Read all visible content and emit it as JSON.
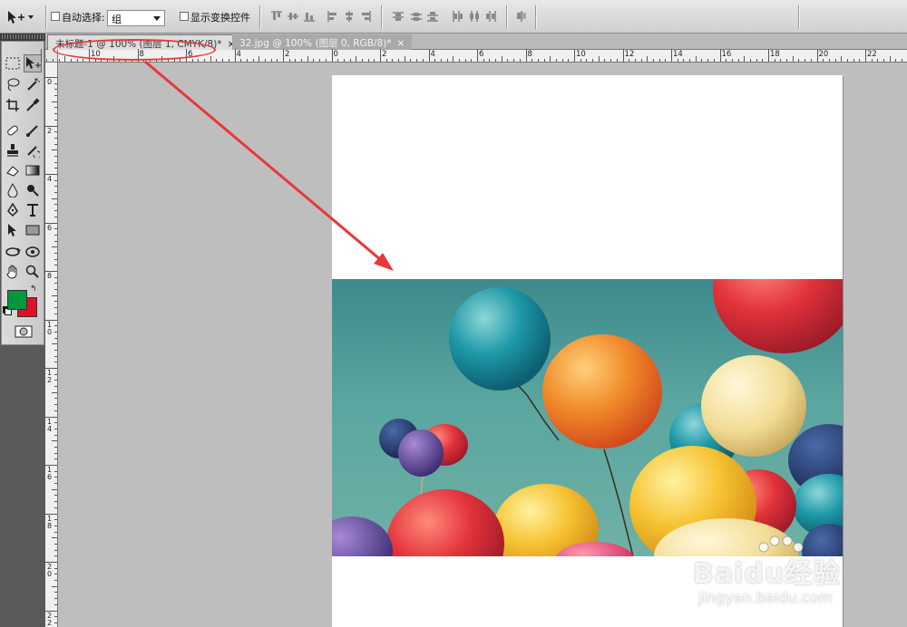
{
  "options_bar": {
    "auto_select_label": "自动选择:",
    "auto_select_value": "组",
    "show_transform_label": "显示变换控件"
  },
  "document_tabs": [
    {
      "label": "未标题-1 @ 100% (图层 1, CMYK/8)*",
      "close": "×",
      "active": true
    },
    {
      "label": "32.jpg @ 100% (图层 0, RGB/8)*",
      "close": "×",
      "active": false
    }
  ],
  "horizontal_ruler": [
    "10",
    "8",
    "6",
    "4",
    "2",
    "0",
    "2",
    "4",
    "6",
    "8",
    "10",
    "12",
    "14",
    "16",
    "18",
    "20",
    "22"
  ],
  "vertical_ruler": [
    "0",
    "2",
    "4",
    "6",
    "8",
    "1 0",
    "1 2",
    "1 4",
    "1 6",
    "1 8",
    "2 0",
    "2 2"
  ],
  "colors": {
    "foreground": "#00963c",
    "background": "#e0102a",
    "annotation": "#e8383a"
  },
  "icons": {
    "move_tool": "move-arrow-icon",
    "marquee": "rect-marquee-icon",
    "lasso": "lasso-icon",
    "magic_wand": "magic-wand-icon",
    "crop": "crop-icon",
    "eyedropper": "eyedropper-icon",
    "healing": "bandage-icon",
    "brush": "brush-icon",
    "stamp": "clone-stamp-icon",
    "history_brush": "history-brush-icon",
    "eraser": "eraser-icon",
    "gradient": "gradient-icon",
    "blur": "blur-drop-icon",
    "dodge": "dodge-icon",
    "pen": "pen-icon",
    "type": "type-icon",
    "path_select": "path-select-icon",
    "shape": "rectangle-shape-icon",
    "3d_rotate": "3d-rotate-icon",
    "3d_orbit": "3d-orbit-icon",
    "hand": "hand-icon",
    "zoom": "zoom-icon",
    "quick_mask": "quick-mask-icon"
  },
  "watermark": {
    "brand": "Baidu经验",
    "url": "jingyan.baidu.com"
  }
}
